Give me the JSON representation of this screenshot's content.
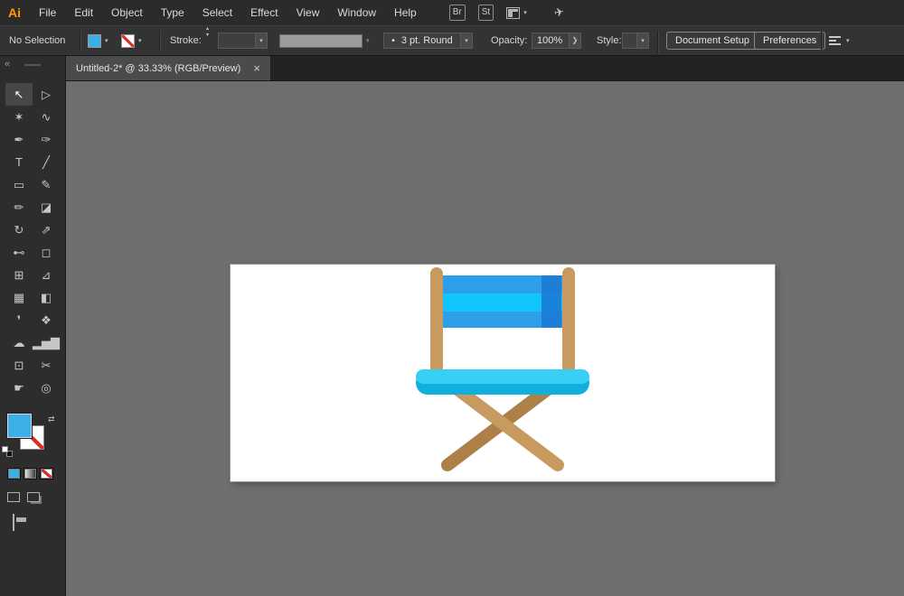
{
  "menubar": {
    "logo": "Ai",
    "items": [
      "File",
      "Edit",
      "Object",
      "Type",
      "Select",
      "Effect",
      "View",
      "Window",
      "Help"
    ],
    "bridge_button": "Br",
    "stock_button": "St"
  },
  "control_bar": {
    "selection_status": "No Selection",
    "stroke_label": "Stroke:",
    "brush_name": "3 pt. Round",
    "opacity_label": "Opacity:",
    "opacity_value": "100%",
    "style_label": "Style:",
    "document_setup_button": "Document Setup",
    "preferences_button": "Preferences"
  },
  "tab": {
    "title": "Untitled-2* @ 33.33% (RGB/Preview)"
  },
  "glyphs": {
    "chevron": "▾",
    "stepper_up": "▴",
    "stepper_down": "▾",
    "collapse": "«",
    "swap": "⇄",
    "more": "❯",
    "close": "×",
    "bullet": "•",
    "share": "✈"
  },
  "tools": [
    {
      "name": "selection",
      "glyph": "↖"
    },
    {
      "name": "direct-selection",
      "glyph": "▷"
    },
    {
      "name": "magic-wand",
      "glyph": "✶"
    },
    {
      "name": "lasso",
      "glyph": "∿"
    },
    {
      "name": "pen",
      "glyph": "✒"
    },
    {
      "name": "curvature",
      "glyph": "✑"
    },
    {
      "name": "type",
      "glyph": "T"
    },
    {
      "name": "line-segment",
      "glyph": "╱"
    },
    {
      "name": "rectangle",
      "glyph": "▭"
    },
    {
      "name": "paintbrush",
      "glyph": "✎"
    },
    {
      "name": "shaper",
      "glyph": "✏"
    },
    {
      "name": "eraser",
      "glyph": "◪"
    },
    {
      "name": "rotate",
      "glyph": "↻"
    },
    {
      "name": "scale",
      "glyph": "⇗"
    },
    {
      "name": "width",
      "glyph": "⊷"
    },
    {
      "name": "free-transform",
      "glyph": "◻"
    },
    {
      "name": "shape-builder",
      "glyph": "⊞"
    },
    {
      "name": "perspective-grid",
      "glyph": "⊿"
    },
    {
      "name": "mesh",
      "glyph": "▦"
    },
    {
      "name": "gradient",
      "glyph": "◧"
    },
    {
      "name": "eyedropper",
      "glyph": "❜"
    },
    {
      "name": "blend",
      "glyph": "❖"
    },
    {
      "name": "symbol-sprayer",
      "glyph": "☁"
    },
    {
      "name": "column-graph",
      "glyph": "▂▅▇"
    },
    {
      "name": "artboard",
      "glyph": "⊡"
    },
    {
      "name": "slice",
      "glyph": "✂"
    },
    {
      "name": "hand",
      "glyph": "☛"
    },
    {
      "name": "zoom",
      "glyph": "◎"
    }
  ],
  "colors": {
    "fill_swatch": "#3BAFE6",
    "logo": "#FF9A00",
    "canvas_bg": "#6E6E6E"
  },
  "artwork": {
    "wood": "#C79A5F",
    "wood_dark": "#AD8048",
    "stripe_mid": "#2C9FE8",
    "stripe_bright": "#12C5FF",
    "stripe_shadow": "#1C7AD4",
    "seat_top": "#38CFF5",
    "seat_bottom": "#10AFDD"
  }
}
